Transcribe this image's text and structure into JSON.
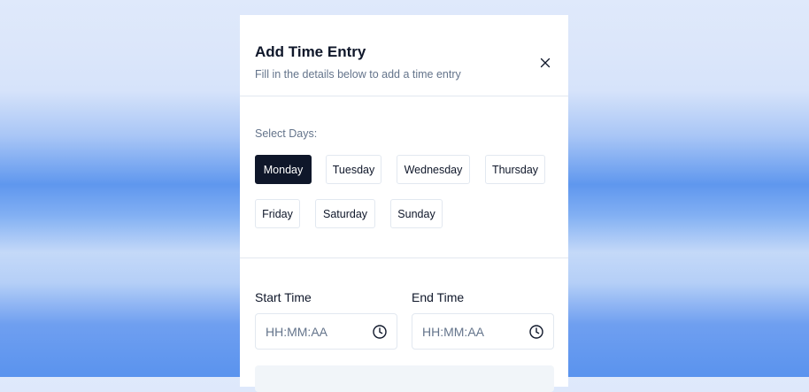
{
  "dialog": {
    "title": "Add Time Entry",
    "subtitle": "Fill in the details below to add a time entry",
    "close_icon": "close-icon"
  },
  "days": {
    "label": "Select Days:",
    "items": [
      {
        "label": "Monday",
        "selected": true
      },
      {
        "label": "Tuesday",
        "selected": false
      },
      {
        "label": "Wednesday",
        "selected": false
      },
      {
        "label": "Thursday",
        "selected": false
      },
      {
        "label": "Friday",
        "selected": false
      },
      {
        "label": "Saturday",
        "selected": false
      },
      {
        "label": "Sunday",
        "selected": false
      }
    ]
  },
  "start_time": {
    "label": "Start Time",
    "placeholder": "HH:MM:AA",
    "value": "",
    "icon": "clock-icon"
  },
  "end_time": {
    "label": "End Time",
    "placeholder": "HH:MM:AA",
    "value": "",
    "icon": "clock-icon"
  },
  "colors": {
    "selected_bg": "#0f172a",
    "border": "#e2e8f0",
    "muted_text": "#64748b"
  }
}
